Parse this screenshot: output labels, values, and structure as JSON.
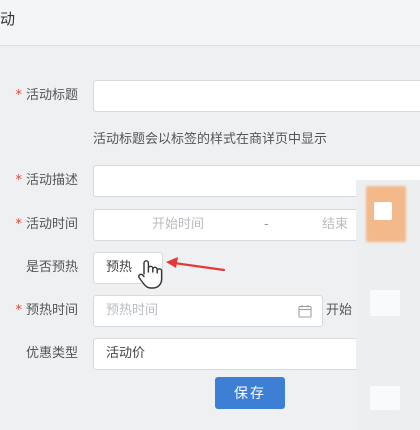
{
  "header": {
    "title": "动"
  },
  "form": {
    "title_row": {
      "label": "活动标题",
      "required": "*",
      "value": ""
    },
    "hint": "活动标题会以标签的样式在商详页中显示",
    "desc_row": {
      "label": "活动描述",
      "required": "*",
      "value": ""
    },
    "time_row": {
      "label": "活动时间",
      "required": "*",
      "start_placeholder": "开始时间",
      "separator": "-",
      "end_placeholder": "结束"
    },
    "preheat_row": {
      "label": "是否预热",
      "value": "预热"
    },
    "preheat_time_row": {
      "label": "预热时间",
      "required": "*",
      "placeholder": "预热时间",
      "after_text": "开始"
    },
    "discount_row": {
      "label": "优惠类型",
      "value": "活动价"
    },
    "save_label": "保存"
  },
  "colors": {
    "accent": "#3e7fd6",
    "required": "#e0453a",
    "arrow": "#e23a3a"
  },
  "icons": [
    "calendar-icon",
    "pointer-hand-icon",
    "arrow-icon"
  ]
}
